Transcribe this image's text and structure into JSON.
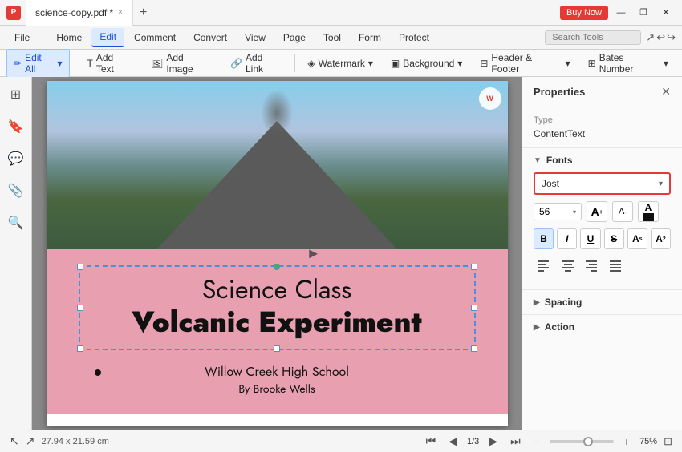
{
  "titleBar": {
    "tabName": "science-copy.pdf *",
    "closeTab": "×",
    "newTab": "+",
    "buyNow": "Buy Now",
    "minimize": "—",
    "maximize": "❐",
    "close": "✕"
  },
  "menuBar": {
    "items": [
      {
        "label": "File",
        "active": false
      },
      {
        "label": "Home",
        "active": false
      },
      {
        "label": "Edit",
        "active": true
      },
      {
        "label": "Comment",
        "active": false
      },
      {
        "label": "Convert",
        "active": false
      },
      {
        "label": "View",
        "active": false
      },
      {
        "label": "Page",
        "active": false
      },
      {
        "label": "Tool",
        "active": false
      },
      {
        "label": "Form",
        "active": false
      },
      {
        "label": "Protect",
        "active": false
      }
    ],
    "searchPlaceholder": "Search Tools"
  },
  "toolbar": {
    "editAll": "Edit All",
    "addText": "Add Text",
    "addImage": "Add Image",
    "addLink": "Add Link",
    "watermark": "Watermark",
    "background": "Background",
    "headerFooter": "Header & Footer",
    "batesNumber": "Bates Number"
  },
  "document": {
    "title": "Science Class",
    "subtitle": "Volcanic Experiment",
    "school": "Willow Creek High School",
    "author": "By Brooke Wells"
  },
  "properties": {
    "panelTitle": "Properties",
    "type": {
      "label": "Type",
      "value": "ContentText"
    },
    "fonts": {
      "label": "Fonts",
      "fontName": "Jost",
      "fontSize": "56",
      "sizeUpLabel": "A",
      "sizeDownLabel": "A",
      "colorLabel": "A"
    },
    "formatButtons": [
      {
        "label": "B",
        "active": true
      },
      {
        "label": "I",
        "active": false
      },
      {
        "label": "U",
        "active": false
      },
      {
        "label": "S",
        "active": false
      },
      {
        "label": "A",
        "active": false
      },
      {
        "label": "A₂",
        "active": false
      }
    ],
    "alignButtons": [
      {
        "label": "≡",
        "name": "align-left"
      },
      {
        "label": "≡",
        "name": "align-center"
      },
      {
        "label": "≡",
        "name": "align-right"
      },
      {
        "label": "≡",
        "name": "align-justify"
      }
    ],
    "spacing": "Spacing",
    "action": "Action"
  },
  "statusBar": {
    "dimensions": "27.94 x 21.59 cm",
    "page": "1",
    "totalPages": "3",
    "zoomLevel": "75%"
  }
}
